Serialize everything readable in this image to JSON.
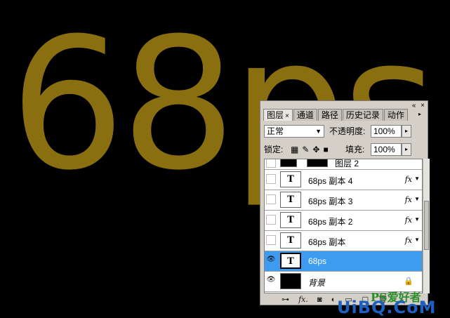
{
  "canvas": {
    "text": "68ps",
    "color": "#8a6f10"
  },
  "panel": {
    "tabs": [
      {
        "label": "图层",
        "close": "×"
      },
      {
        "label": "通道"
      },
      {
        "label": "路径"
      },
      {
        "label": "历史记录"
      },
      {
        "label": "动作"
      }
    ],
    "top_buttons": {
      "minimize": "«",
      "close": "×"
    },
    "menu_icon": "▸",
    "blend_mode": "正常",
    "opacity_label": "不透明度:",
    "opacity_value": "100%",
    "lock_label": "锁定:",
    "fill_label": "填充:",
    "fill_value": "100%",
    "layers": [
      {
        "name": "图层 2",
        "thumb": "",
        "fx": "",
        "visible": false
      },
      {
        "name": "68ps 副本 4",
        "thumb": "T",
        "fx": "fx",
        "visible": false
      },
      {
        "name": "68ps 副本 3",
        "thumb": "T",
        "fx": "fx",
        "visible": false
      },
      {
        "name": "68ps 副本 2",
        "thumb": "T",
        "fx": "fx",
        "visible": false
      },
      {
        "name": "68ps 副本",
        "thumb": "T",
        "fx": "fx",
        "visible": false
      },
      {
        "name": "68ps",
        "thumb": "T",
        "fx": "",
        "visible": true,
        "selected": true
      },
      {
        "name": "背景",
        "thumb": "",
        "fx": "",
        "visible": true,
        "locked": true
      }
    ],
    "bottom_icons": [
      "link-icon",
      "fx-icon",
      "mask-icon",
      "adjustment-icon",
      "folder-icon",
      "new-layer-icon",
      "trash-icon"
    ],
    "bottom_fx": "fx."
  },
  "watermark": {
    "line1": "PS爱好者",
    "line2": "UiBQ.CoM"
  }
}
